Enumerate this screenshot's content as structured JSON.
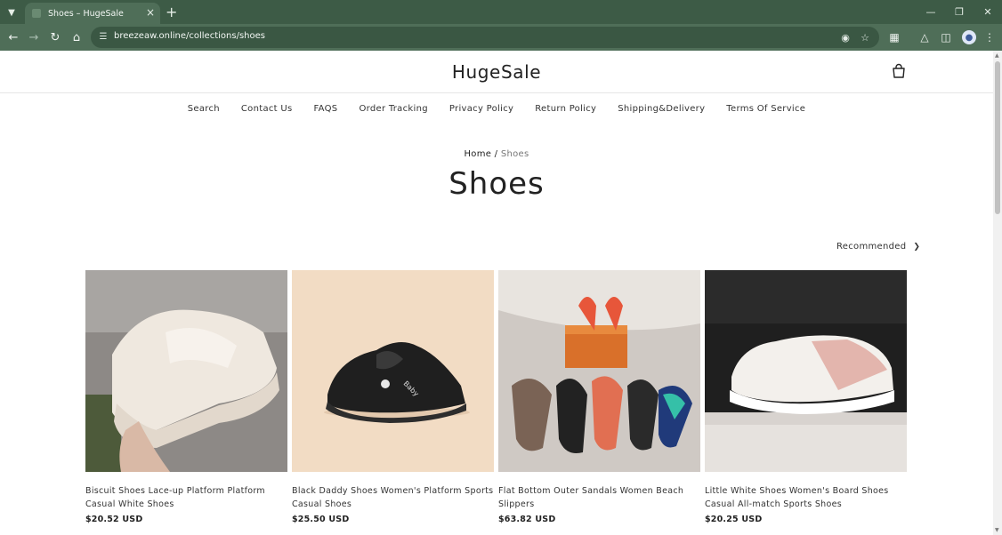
{
  "browser": {
    "tab_title": "Shoes – HugeSale",
    "url": "breezeaw.online/collections/shoes"
  },
  "store": {
    "logo": "HugeSale"
  },
  "menu": [
    {
      "label": "Search"
    },
    {
      "label": "Contact Us"
    },
    {
      "label": "FAQS"
    },
    {
      "label": "Order Tracking"
    },
    {
      "label": "Privacy Policy"
    },
    {
      "label": "Return Policy"
    },
    {
      "label": "Shipping&Delivery"
    },
    {
      "label": "Terms Of Service"
    }
  ],
  "breadcrumb": {
    "home": "Home",
    "separator": " / ",
    "current": "Shoes"
  },
  "collection": {
    "title": "Shoes",
    "sort_label": "Recommended"
  },
  "products": [
    {
      "title": "Biscuit Shoes Lace-up Platform Platform Casual White Shoes",
      "price": "$20.52 USD"
    },
    {
      "title": "Black Daddy Shoes Women's Platform Sports Casual Shoes",
      "price": "$25.50 USD"
    },
    {
      "title": "Flat Bottom Outer Sandals Women Beach Slippers",
      "price": "$63.82 USD"
    },
    {
      "title": "Little White Shoes Women's Board Shoes Casual All-match Sports Shoes",
      "price": "$20.25 USD"
    }
  ],
  "colors": {
    "browser_frame": "#3d5b46",
    "toolbar": "#4f6e58",
    "text": "#222222"
  }
}
